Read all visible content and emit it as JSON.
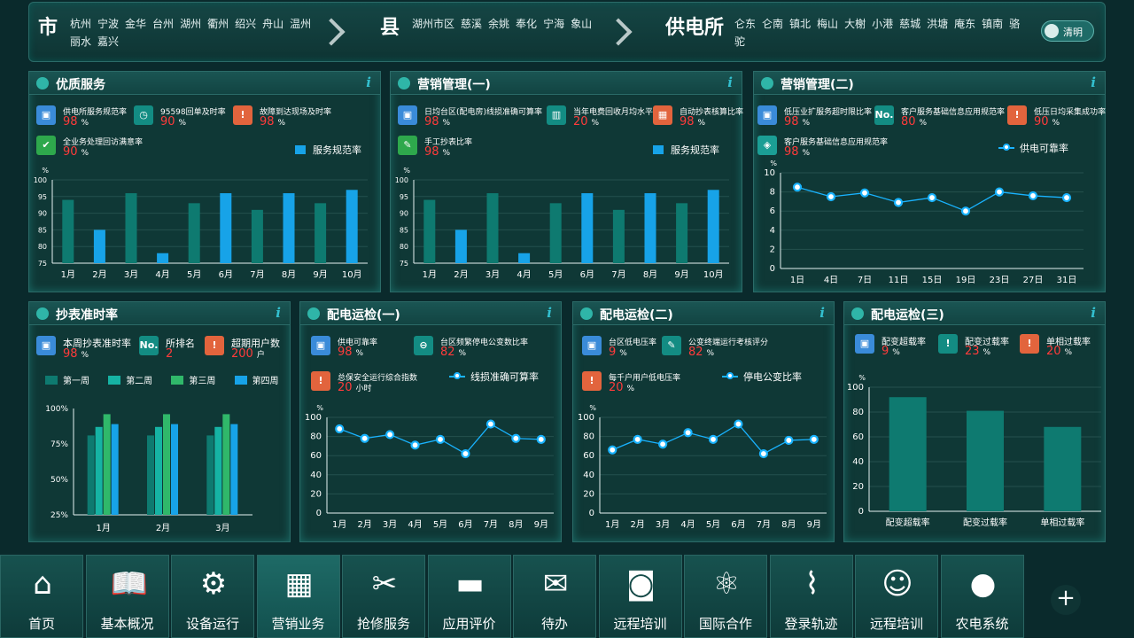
{
  "topbar": {
    "levels": [
      {
        "label": "市",
        "items": [
          "杭州",
          "宁波",
          "金华",
          "台州",
          "湖州",
          "衢州",
          "绍兴",
          "舟山",
          "温州",
          "丽水",
          "嘉兴"
        ]
      },
      {
        "label": "县",
        "items": [
          "湖州市区",
          "慈溪",
          "余姚",
          "奉化",
          "宁海",
          "象山"
        ]
      },
      {
        "label": "供电所",
        "items": [
          "仑东",
          "仑南",
          "镇北",
          "梅山",
          "大榭",
          "小港",
          "慈城",
          "洪塘",
          "庵东",
          "镇南",
          "骆驼"
        ]
      }
    ],
    "toggle_label": "清明"
  },
  "colors": {
    "accent": "#17a3e8",
    "bar_teal": "#0e7a70",
    "alert_red": "#ff3b3b"
  },
  "panels": {
    "p1": {
      "title": "优质服务",
      "kpis": [
        {
          "label": "供电所服务规范率",
          "value": "98",
          "unit": "%",
          "icon": "cube-icon",
          "color": "blue"
        },
        {
          "label": "95598回单及时率",
          "value": "90",
          "unit": "%",
          "icon": "clock-icon",
          "color": "teal"
        },
        {
          "label": "故障到达现场及时率",
          "value": "98",
          "unit": "%",
          "icon": "alert-icon",
          "color": "orange"
        },
        {
          "label": "全业务处理回访满意率",
          "value": "90",
          "unit": "%",
          "icon": "check-icon",
          "color": "green"
        }
      ],
      "legend": "服务规范率"
    },
    "p2": {
      "title": "营销管理(一)",
      "kpis": [
        {
          "label": "日均台区(配电房)线损准确可算率",
          "value": "98",
          "unit": "%",
          "icon": "cube-icon",
          "color": "blue"
        },
        {
          "label": "当年电费回收月均水平",
          "value": "20",
          "unit": "%",
          "icon": "bar-chart-icon",
          "color": "teal"
        },
        {
          "label": "自动抄表核算比率",
          "value": "98",
          "unit": "%",
          "icon": "calculator-icon",
          "color": "orange"
        },
        {
          "label": "手工抄表比率",
          "value": "98",
          "unit": "%",
          "icon": "pen-icon",
          "color": "green"
        }
      ],
      "legend": "服务规范率"
    },
    "p3": {
      "title": "营销管理(二)",
      "kpis": [
        {
          "label": "低压业扩服务超时限比率",
          "value": "98",
          "unit": "%",
          "icon": "cube-icon",
          "color": "blue"
        },
        {
          "label": "客户服务基础信息应用规范率",
          "value": "80",
          "unit": "%",
          "icon": "no-icon",
          "color": "teal"
        },
        {
          "label": "低压日均采集成功率",
          "value": "90",
          "unit": "%",
          "icon": "alert-icon",
          "color": "orange"
        },
        {
          "label": "客户服务基础信息应用规范率",
          "value": "98",
          "unit": "%",
          "icon": "tag-icon",
          "color": "cyan"
        }
      ],
      "legend": "供电可靠率"
    },
    "p4": {
      "title": "抄表准时率",
      "kpis": [
        {
          "label": "本周抄表准时率",
          "value": "98",
          "unit": "%",
          "icon": "cube-icon",
          "color": "blue"
        },
        {
          "label": "所排名",
          "value": "2",
          "unit": "",
          "icon": "no-icon",
          "color": "teal"
        },
        {
          "label": "超期用户数",
          "value": "200",
          "unit": "户",
          "icon": "alert-icon",
          "color": "orange"
        }
      ],
      "legend": [
        "第一周",
        "第二周",
        "第三周",
        "第四周"
      ]
    },
    "p5": {
      "title": "配电运检(一)",
      "kpis": [
        {
          "label": "供电可靠率",
          "value": "98",
          "unit": "%",
          "icon": "cube-icon",
          "color": "blue"
        },
        {
          "label": "台区频繁停电公变数比率",
          "value": "82",
          "unit": "%",
          "icon": "minus-icon",
          "color": "teal"
        },
        {
          "label": "总保安全运行综合指数",
          "value": "20",
          "unit": "小时",
          "icon": "alert-icon",
          "color": "orange"
        }
      ],
      "legend": "线损准确可算率"
    },
    "p6": {
      "title": "配电运检(二)",
      "kpis": [
        {
          "label": "台区低电压率",
          "value": "9",
          "unit": "%",
          "icon": "cube-icon",
          "color": "blue"
        },
        {
          "label": "公变终端运行考核评分",
          "value": "82",
          "unit": "%",
          "icon": "pen-icon",
          "color": "teal"
        },
        {
          "label": "每千户用户低电压率",
          "value": "20",
          "unit": "%",
          "icon": "alert-icon",
          "color": "orange"
        }
      ],
      "legend": "停电公变比率"
    },
    "p7": {
      "title": "配电运检(三)",
      "kpis": [
        {
          "label": "配变超载率",
          "value": "9",
          "unit": "%",
          "icon": "cube-icon",
          "color": "blue"
        },
        {
          "label": "配变过载率",
          "value": "23",
          "unit": "%",
          "icon": "alert-circle-icon",
          "color": "teal"
        },
        {
          "label": "单相过载率",
          "value": "20",
          "unit": "%",
          "icon": "alert-icon",
          "color": "orange"
        }
      ]
    }
  },
  "chart_data": [
    {
      "type": "bar",
      "ylabel": "%",
      "ylim": [
        75,
        100
      ],
      "yticks": [
        "100",
        "95",
        "90",
        "85",
        "80",
        "75"
      ],
      "categories": [
        "1月",
        "2月",
        "3月",
        "4月",
        "5月",
        "6月",
        "7月",
        "8月",
        "9月",
        "10月"
      ],
      "values": [
        94,
        85,
        96,
        78,
        93,
        96,
        91,
        96,
        93,
        97
      ]
    },
    {
      "type": "bar",
      "ylabel": "%",
      "ylim": [
        75,
        100
      ],
      "yticks": [
        "100",
        "95",
        "90",
        "85",
        "80",
        "75"
      ],
      "categories": [
        "1月",
        "2月",
        "3月",
        "4月",
        "5月",
        "6月",
        "7月",
        "8月",
        "9月",
        "10月"
      ],
      "values": [
        94,
        85,
        96,
        78,
        93,
        96,
        91,
        96,
        93,
        97
      ]
    },
    {
      "type": "line",
      "ylabel": "%",
      "ylim": [
        0,
        10
      ],
      "yticks": [
        "10",
        "8",
        "6",
        "4",
        "2",
        "0"
      ],
      "x": [
        "1日",
        "4日",
        "7日",
        "11日",
        "15日",
        "19日",
        "23日",
        "27日",
        "31日"
      ],
      "values": [
        8.5,
        7.5,
        7.9,
        6.9,
        7.4,
        6.0,
        8.0,
        7.6,
        7.4
      ]
    },
    {
      "type": "bar",
      "ylim": [
        25,
        100
      ],
      "yticks": [
        "100%",
        "75%",
        "50%",
        "25%"
      ],
      "categories": [
        "1月",
        "2月",
        "3月"
      ],
      "series": [
        {
          "name": "第一周",
          "values": [
            81,
            81,
            81
          ]
        },
        {
          "name": "第二周",
          "values": [
            87,
            87,
            87
          ]
        },
        {
          "name": "第三周",
          "values": [
            96,
            96,
            96
          ]
        },
        {
          "name": "第四周",
          "values": [
            89,
            89,
            89
          ]
        }
      ]
    },
    {
      "type": "line",
      "ylabel": "%",
      "ylim": [
        0,
        100
      ],
      "yticks": [
        "100",
        "80",
        "60",
        "40",
        "20",
        "0"
      ],
      "x": [
        "1月",
        "2月",
        "3月",
        "4月",
        "5月",
        "6月",
        "7月",
        "8月",
        "9月"
      ],
      "values": [
        88,
        78,
        82,
        71,
        77,
        62,
        93,
        78,
        77
      ]
    },
    {
      "type": "line",
      "ylabel": "%",
      "ylim": [
        0,
        100
      ],
      "yticks": [
        "100",
        "80",
        "60",
        "40",
        "20",
        "0"
      ],
      "x": [
        "1月",
        "2月",
        "3月",
        "4月",
        "5月",
        "6月",
        "7月",
        "8月",
        "9月"
      ],
      "values": [
        66,
        77,
        72,
        84,
        77,
        93,
        62,
        76,
        77
      ]
    },
    {
      "type": "bar",
      "ylabel": "%",
      "ylim": [
        0,
        100
      ],
      "yticks": [
        "100",
        "80",
        "60",
        "40",
        "20",
        "0"
      ],
      "categories": [
        "配变超载率",
        "配变过载率",
        "单相过载率"
      ],
      "values": [
        92,
        81,
        68
      ]
    }
  ],
  "nav": [
    {
      "label": "首页",
      "icon": "home-icon"
    },
    {
      "label": "基本概况",
      "icon": "book-icon"
    },
    {
      "label": "设备运行",
      "icon": "gear-icon"
    },
    {
      "label": "营销业务",
      "icon": "presentation-icon"
    },
    {
      "label": "抢修服务",
      "icon": "tools-icon"
    },
    {
      "label": "应用评价",
      "icon": "comment-icon"
    },
    {
      "label": "待办",
      "icon": "mail-icon"
    },
    {
      "label": "远程培训",
      "icon": "camera-icon"
    },
    {
      "label": "国际合作",
      "icon": "atom-icon"
    },
    {
      "label": "登录轨迹",
      "icon": "line-chart-icon"
    },
    {
      "label": "远程培训",
      "icon": "user-check-icon"
    },
    {
      "label": "农电系统",
      "icon": "bulb-icon"
    }
  ],
  "plus_label": "+"
}
